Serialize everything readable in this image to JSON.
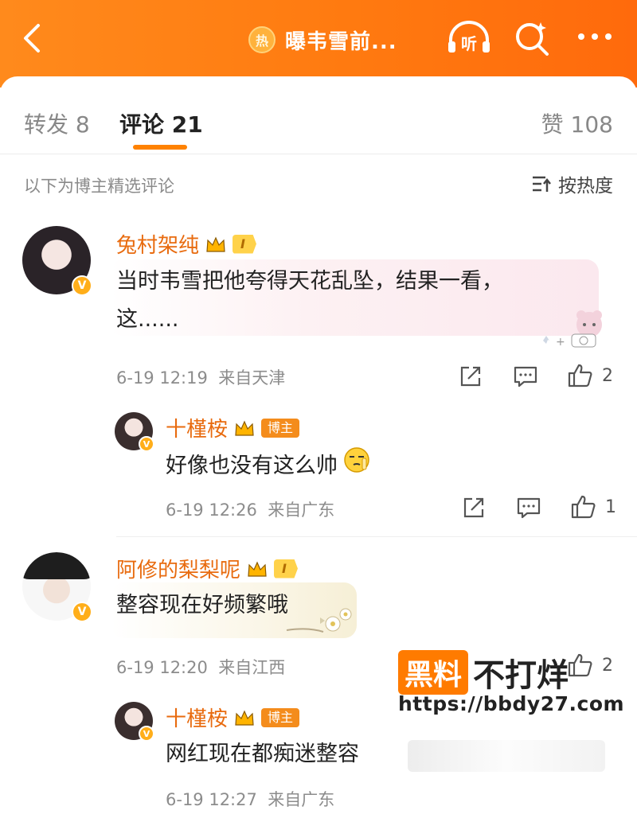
{
  "header": {
    "title": "曝韦雪前...",
    "hot_badge": "热",
    "listen_label": "听",
    "colors": {
      "accent": "#ff7a10",
      "username": "#e86b0f",
      "level_badge": "#ffd24a"
    }
  },
  "tabs": [
    {
      "label": "转发 8"
    },
    {
      "label": "评论 21"
    },
    {
      "label": "赞 108"
    }
  ],
  "subheader": {
    "text": "以下为博主精选评论",
    "sort_label": "按热度"
  },
  "comments": [
    {
      "user": "兔村架纯",
      "level": "I",
      "text_line1": "当时韦雪把他夸得天花乱坠，结果一看，",
      "text_line2": "这......",
      "time": "6-19 12:19",
      "location": "来自天津",
      "likes": "2",
      "reply": {
        "user": "十槿桉",
        "tag": "博主",
        "text": "好像也没有这么帅",
        "time": "6-19 12:26",
        "location": "来自广东",
        "likes": "1"
      }
    },
    {
      "user": "阿修的梨梨呢",
      "level": "I",
      "text": "整容现在好频繁哦",
      "time": "6-19 12:20",
      "location": "来自江西",
      "likes": "2",
      "reply": {
        "user": "十槿桉",
        "tag": "博主",
        "text": "网红现在都痴迷整容",
        "time": "6-19 12:27",
        "location": "来自广东"
      }
    }
  ],
  "watermark": {
    "brand": "黑料",
    "text": "不打烊",
    "url": "https://bbdy27.com"
  }
}
